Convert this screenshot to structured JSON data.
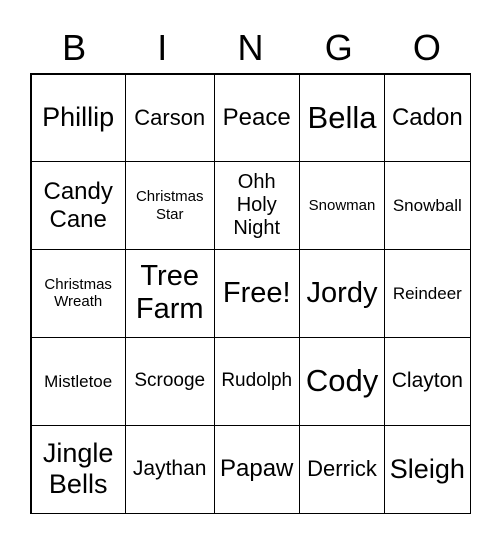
{
  "header": [
    "B",
    "I",
    "N",
    "G",
    "O"
  ],
  "cells": [
    "Phillip",
    "Carson",
    "Peace",
    "Bella",
    "Cadon",
    "Candy Cane",
    "Christmas Star",
    "Ohh Holy Night",
    "Snowman",
    "Snowball",
    "Christmas Wreath",
    "Tree Farm",
    "Free!",
    "Jordy",
    "Reindeer",
    "Mistletoe",
    "Scrooge",
    "Rudolph",
    "Cody",
    "Clayton",
    "Jingle Bells",
    "Jaythan",
    "Papaw",
    "Derrick",
    "Sleigh"
  ]
}
